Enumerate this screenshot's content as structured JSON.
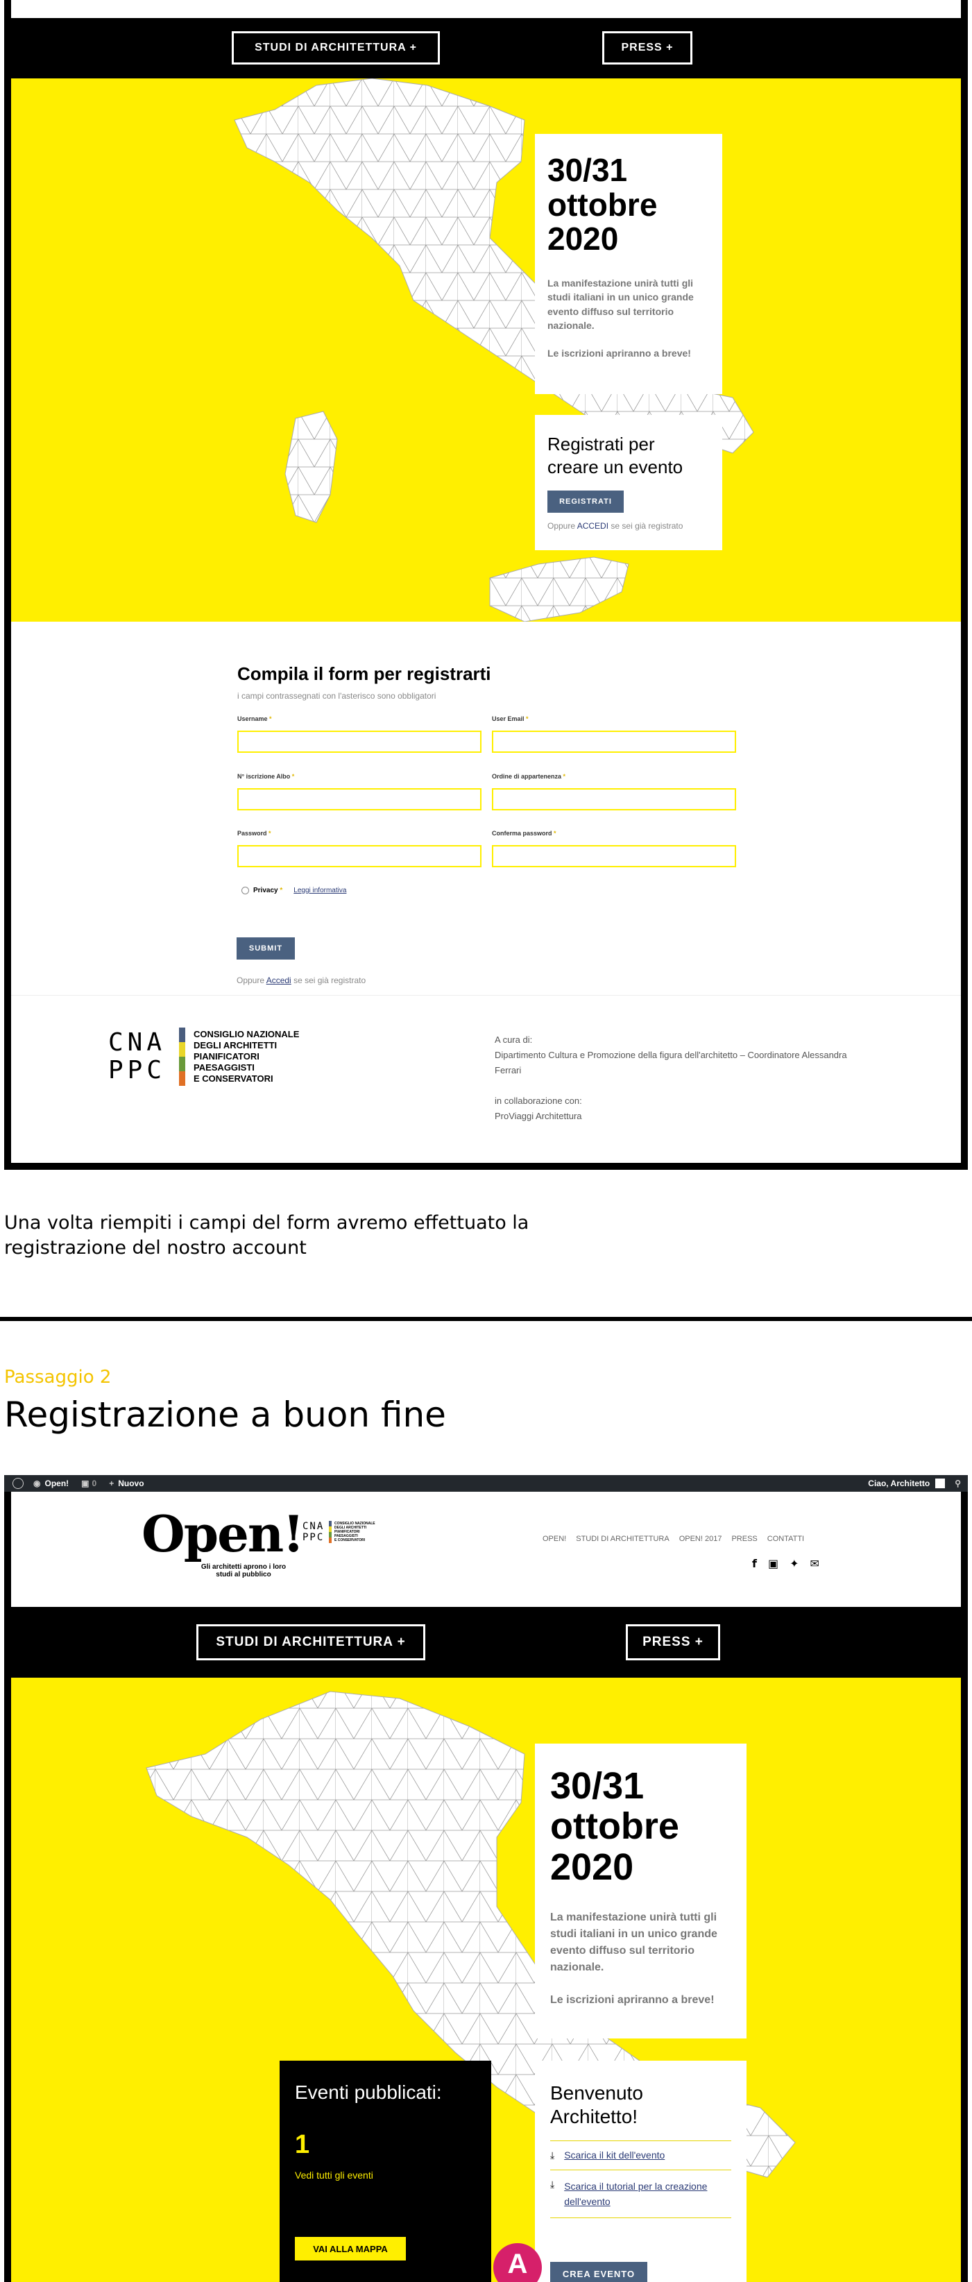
{
  "shot1": {
    "nav": {
      "studi": "STUDI DI ARCHITETTURA +",
      "press": "PRESS +"
    },
    "event": {
      "date": "30/31 ottobre 2020",
      "description": "La manifestazione unirà tutti gli studi italiani in un unico grande evento diffuso sul territorio nazionale.",
      "note": "Le iscrizioni apriranno a breve!"
    },
    "register_card": {
      "title": "Registrati per creare un evento",
      "button": "REGISTRATI",
      "alt_prefix": "Oppure",
      "alt_link": "ACCEDI",
      "alt_suffix": "se sei già registrato"
    },
    "form": {
      "title": "Compila il form per registrarti",
      "subtitle": "i campi contrassegnati con l'asterisco sono obbligatori",
      "fields": {
        "username": "Username",
        "email": "User Email",
        "albo": "N° iscrizione Albo",
        "ordine": "Ordine di appartenenza",
        "password": "Password",
        "confirm": "Conferma password"
      },
      "required_mark": "*",
      "privacy": "Privacy",
      "privacy_link": "Leggi informativa",
      "submit": "SUBMIT",
      "alt_prefix": "Oppure",
      "alt_link": "Accedi",
      "alt_suffix": "se sei già registrato"
    },
    "footer": {
      "logo_letters": "CNA PPC",
      "logo_text": [
        "CONSIGLIO NAZIONALE",
        "DEGLI ARCHITETTI",
        "PIANIFICATORI",
        "PAESAGGISTI",
        "E CONSERVATORI"
      ],
      "curated_label": "A cura di:",
      "curated_by": "Dipartimento Cultura e Promozione della figura dell'architetto – Coordinatore Alessandra Ferrari",
      "collab_label": "in collaborazione con:",
      "collab": "ProViaggi Architettura"
    }
  },
  "caption": "Una volta riempiti i campi del form avremo effettuato la registrazione del nostro account",
  "step": {
    "label": "Passaggio 2",
    "title": "Registrazione a buon fine"
  },
  "shot2": {
    "adminbar": {
      "site": "Open!",
      "comments": "0",
      "new": "Nuovo",
      "greeting": "Ciao, Architetto"
    },
    "header": {
      "logo": "Open!",
      "logo_sub": "Gli architetti aprono i loro studi al pubblico",
      "menu": [
        "OPEN!",
        "STUDI DI ARCHITETTURA",
        "OPEN! 2017",
        "PRESS",
        "CONTATTI"
      ]
    },
    "nav": {
      "studi": "STUDI DI ARCHITETTURA +",
      "press": "PRESS +"
    },
    "event": {
      "date": "30/31 ottobre 2020",
      "description": "La manifestazione unirà tutti gli studi italiani in un unico grande evento diffuso sul territorio nazionale.",
      "note": "Le iscrizioni apriranno a breve!"
    },
    "events_box": {
      "title": "Eventi pubblicati:",
      "count": "1",
      "link": "Vedi tutti gli eventi",
      "button": "VAI ALLA MAPPA"
    },
    "welcome": {
      "title": "Benvenuto Architetto!",
      "links": [
        "Scarica il kit dell'evento",
        "Scarica il tutorial per la creazione dell'evento"
      ],
      "button": "CREA EVENTO"
    },
    "marker": "A"
  }
}
